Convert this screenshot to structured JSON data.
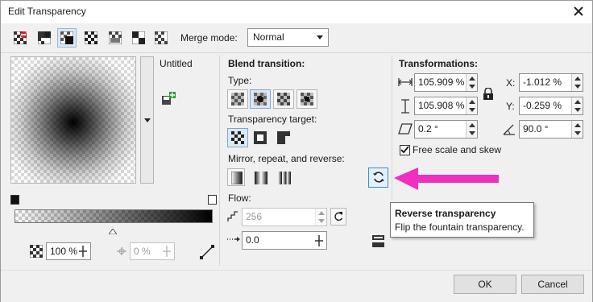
{
  "window": {
    "title": "Edit Transparency"
  },
  "toolbar": {
    "tools": [
      {
        "name": "no-transparency"
      },
      {
        "name": "uniform"
      },
      {
        "name": "fountain"
      },
      {
        "name": "vector-pattern"
      },
      {
        "name": "bitmap-pattern"
      },
      {
        "name": "two-color"
      },
      {
        "name": "texture"
      }
    ],
    "merge_label": "Merge mode:",
    "merge_value": "Normal"
  },
  "preview": {
    "name": "Untitled"
  },
  "bottom_left": {
    "opacity_value": "100 %",
    "midpoint_value": "0 %"
  },
  "blend": {
    "heading": "Blend transition:",
    "type_label": "Type:",
    "target_label": "Transparency target:",
    "mirror_label": "Mirror, repeat, and reverse:",
    "flow_label": "Flow:",
    "steps_value": "256",
    "acceleration_value": "0.0"
  },
  "transform": {
    "heading": "Transformations:",
    "width_value": "105.909 %",
    "height_value": "105.908 %",
    "skew_value": "0.2 °",
    "x_label": "X:",
    "x_value": "-1.012 %",
    "y_label": "Y:",
    "y_value": "-0.259 %",
    "rotate_value": "90.0 °",
    "free_scale_label": "Free scale and skew",
    "free_scale_checked": true
  },
  "tooltip": {
    "title": "Reverse transparency",
    "body": "Flip the fountain transparency."
  },
  "buttons": {
    "ok": "OK",
    "cancel": "Cancel"
  },
  "colors": {
    "annotation_arrow": "#ee2fbf",
    "selection_blue": "#2f8fd9"
  }
}
